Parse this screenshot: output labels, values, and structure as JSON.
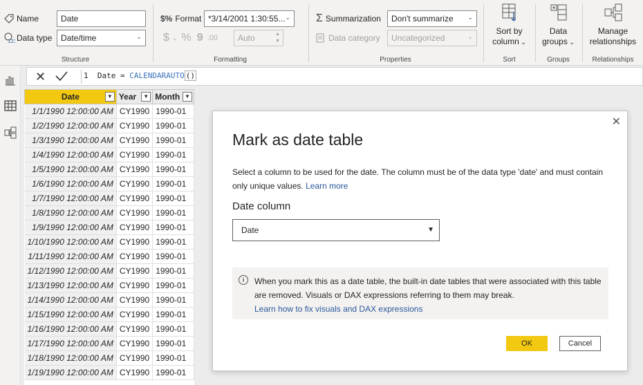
{
  "ribbon": {
    "structure": {
      "title": "Structure",
      "name_label": "Name",
      "name_value": "Date",
      "datatype_label": "Data type",
      "datatype_value": "Date/time"
    },
    "formatting": {
      "title": "Formatting",
      "format_label": "Format",
      "format_value": "*3/14/2001 1:30:55...",
      "currency_symbol": "$",
      "percent_symbol": "%",
      "comma_symbol": "9",
      "decimals_symbol": ".00",
      "auto_value": "Auto"
    },
    "properties": {
      "title": "Properties",
      "summarization_label": "Summarization",
      "summarization_value": "Don't summarize",
      "category_label": "Data category",
      "category_value": "Uncategorized"
    },
    "sort": {
      "title": "Sort",
      "button_line1": "Sort by",
      "button_line2": "column"
    },
    "groups": {
      "title": "Groups",
      "button_line1": "Data",
      "button_line2": "groups"
    },
    "relationships": {
      "title": "Relationships",
      "button_line1": "Manage",
      "button_line2": "relationships"
    }
  },
  "formula": {
    "line_no": "1",
    "lhs": "Date =",
    "fn": "CALENDARAUTO",
    "parens": "()"
  },
  "table": {
    "headers": [
      "Date",
      "Year",
      "Month"
    ],
    "rows": [
      [
        "1/1/1990 12:00:00 AM",
        "CY1990",
        "1990-01"
      ],
      [
        "1/2/1990 12:00:00 AM",
        "CY1990",
        "1990-01"
      ],
      [
        "1/3/1990 12:00:00 AM",
        "CY1990",
        "1990-01"
      ],
      [
        "1/4/1990 12:00:00 AM",
        "CY1990",
        "1990-01"
      ],
      [
        "1/5/1990 12:00:00 AM",
        "CY1990",
        "1990-01"
      ],
      [
        "1/6/1990 12:00:00 AM",
        "CY1990",
        "1990-01"
      ],
      [
        "1/7/1990 12:00:00 AM",
        "CY1990",
        "1990-01"
      ],
      [
        "1/8/1990 12:00:00 AM",
        "CY1990",
        "1990-01"
      ],
      [
        "1/9/1990 12:00:00 AM",
        "CY1990",
        "1990-01"
      ],
      [
        "1/10/1990 12:00:00 AM",
        "CY1990",
        "1990-01"
      ],
      [
        "1/11/1990 12:00:00 AM",
        "CY1990",
        "1990-01"
      ],
      [
        "1/12/1990 12:00:00 AM",
        "CY1990",
        "1990-01"
      ],
      [
        "1/13/1990 12:00:00 AM",
        "CY1990",
        "1990-01"
      ],
      [
        "1/14/1990 12:00:00 AM",
        "CY1990",
        "1990-01"
      ],
      [
        "1/15/1990 12:00:00 AM",
        "CY1990",
        "1990-01"
      ],
      [
        "1/16/1990 12:00:00 AM",
        "CY1990",
        "1990-01"
      ],
      [
        "1/17/1990 12:00:00 AM",
        "CY1990",
        "1990-01"
      ],
      [
        "1/18/1990 12:00:00 AM",
        "CY1990",
        "1990-01"
      ],
      [
        "1/19/1990 12:00:00 AM",
        "CY1990",
        "1990-01"
      ]
    ]
  },
  "dialog": {
    "title": "Mark as date table",
    "description": "Select a column to be used for the date. The column must be of the data type 'date' and must contain only unique values.",
    "learn_more": "Learn more",
    "date_column_label": "Date column",
    "date_column_value": "Date",
    "info_text": "When you mark this as a date table, the built-in date tables that were associated with this table are removed. Visuals or DAX expressions referring to them may break.",
    "info_link": "Learn how to fix visuals and DAX expressions",
    "ok_label": "OK",
    "cancel_label": "Cancel"
  },
  "colors": {
    "accent": "#f2c811",
    "link": "#2b579a",
    "ribbon_bg": "#f3f2f1"
  }
}
